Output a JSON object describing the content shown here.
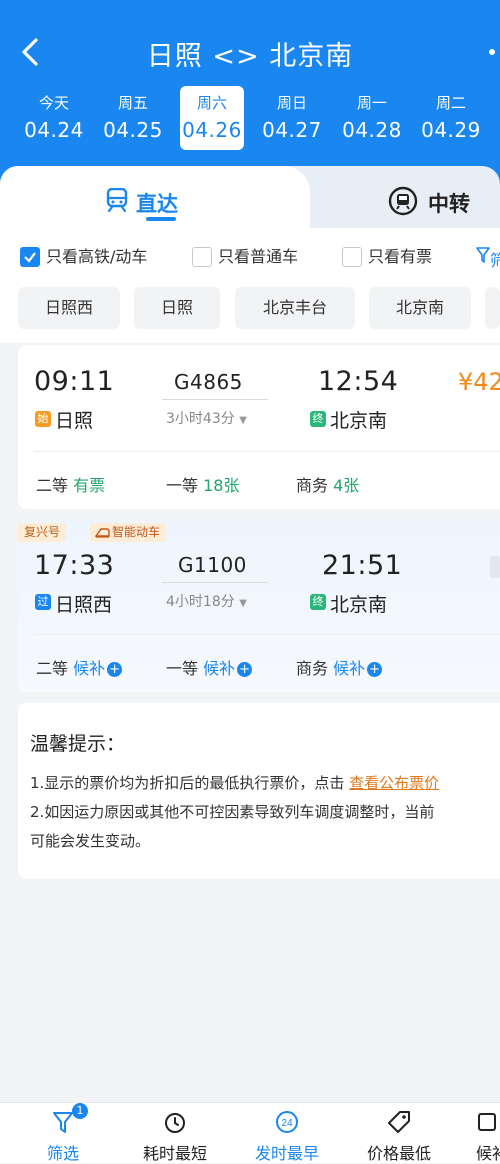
{
  "header": {
    "title": "日照 <> 北京南",
    "dates": [
      {
        "weekday": "今天",
        "date": "04.24",
        "active": false
      },
      {
        "weekday": "周五",
        "date": "04.25",
        "active": false
      },
      {
        "weekday": "周六",
        "date": "04.26",
        "active": true
      },
      {
        "weekday": "周日",
        "date": "04.27",
        "active": false
      },
      {
        "weekday": "周一",
        "date": "04.28",
        "active": false
      },
      {
        "weekday": "周二",
        "date": "04.29",
        "active": false
      }
    ]
  },
  "tabs": {
    "direct": "直达",
    "transfer": "中转"
  },
  "filters": {
    "checkboxes": [
      {
        "label": "只看高铁/动车",
        "checked": true
      },
      {
        "label": "只看普通车",
        "checked": false
      },
      {
        "label": "只看有票",
        "checked": false
      }
    ],
    "more": "筛",
    "stations": [
      "日照西",
      "日照",
      "北京丰台",
      "北京南"
    ]
  },
  "trains": [
    {
      "depart_time": "09:11",
      "arrive_time": "12:54",
      "train_no": "G4865",
      "duration": "3小时43分",
      "from_tag": "始",
      "from": "日照",
      "to_tag": "终",
      "to": "北京南",
      "price": "¥42",
      "seats": [
        {
          "class": "二等",
          "status": "有票"
        },
        {
          "class": "一等",
          "status": "18张"
        },
        {
          "class": "商务",
          "status": "4张"
        }
      ]
    },
    {
      "badges": [
        "复兴号",
        "智能动车"
      ],
      "depart_time": "17:33",
      "arrive_time": "21:51",
      "train_no": "G1100",
      "duration": "4小时18分",
      "from_tag": "过",
      "from": "日照西",
      "to_tag": "终",
      "to": "北京南",
      "seats": [
        {
          "class": "二等",
          "status": "候补"
        },
        {
          "class": "一等",
          "status": "候补"
        },
        {
          "class": "商务",
          "status": "候补"
        }
      ]
    }
  ],
  "notice": {
    "title": "温馨提示：",
    "line1_prefix": "1.显示的票价均为折扣后的最低执行票价，点击 ",
    "line1_link": "查看公布票价",
    "line2": "2.如因运力原因或其他不可控因素导致列车调度调整时，当前",
    "line3": "可能会发生变动。"
  },
  "bottom_nav": [
    {
      "label": "筛选",
      "badge": "1"
    },
    {
      "label": "耗时最短"
    },
    {
      "label": "发时最早",
      "icon_text": "24"
    },
    {
      "label": "价格最低"
    },
    {
      "label": "候补"
    }
  ],
  "colors": {
    "primary": "#1a86f0",
    "available": "#21a56b",
    "price": "#f08a19",
    "start_tag": "#f59a23",
    "end_tag": "#2db67c"
  }
}
